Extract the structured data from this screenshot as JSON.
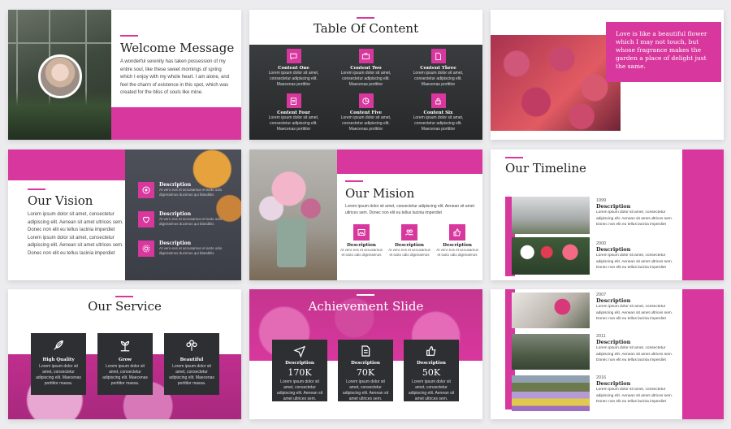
{
  "welcome": {
    "title": "Welcome Message",
    "body": "A wonderful serenity has taken possession of my entire soul, like these sweet mornings of spring which I enjoy with my whole heart. I am alone, and feel the charm of existence in this spot, which was created for the bliss of souls like mine."
  },
  "toc": {
    "title": "Table Of Content",
    "items": [
      {
        "label": "Content One",
        "icon": "chat-bubble-icon"
      },
      {
        "label": "Content Two",
        "icon": "briefcase-icon"
      },
      {
        "label": "Content Three",
        "icon": "document-icon"
      },
      {
        "label": "Content Four",
        "icon": "clipboard-icon"
      },
      {
        "label": "Content Five",
        "icon": "pie-chart-icon"
      },
      {
        "label": "Content Six",
        "icon": "lock-icon"
      }
    ],
    "text": "Lorem ipsum dolor sit amet, consectetur adipiscing elit. Maecenas porttitor"
  },
  "quote": {
    "text": "Love is like a beautiful flower which I may not touch, but whose fragrance makes the garden a place of delight just the same."
  },
  "vision": {
    "title": "Our Vision",
    "body": "Lorem ipsum dolor sit amet, consectetur adipiscing elit. Aenean sit amet ultrices sem. Donec non elit eu tellus lacinia imperdiet Lorem ipsum dolor sit amet, consectetur adipiscing elit. Aenean sit amet ultrices sem. Donec non elit eu tellus lacinia imperdiet",
    "items": [
      {
        "label": "Description",
        "icon": "target-icon"
      },
      {
        "label": "Description",
        "icon": "heart-icon"
      },
      {
        "label": "Description",
        "icon": "gear-icon"
      }
    ],
    "item_text": "At vero eos et accusamus et iusto odio dignissimos ducimus qui blanditiis"
  },
  "mission": {
    "title": "Our Mision",
    "body": "Lorem ipsum dolor sit amet, consectetur adipiscing elit. Aenean sit amet ultrices sem. Donec non elit eu tellus lacinia imperdiet",
    "items": [
      {
        "label": "Description",
        "icon": "picture-icon"
      },
      {
        "label": "Description",
        "icon": "people-icon"
      },
      {
        "label": "Description",
        "icon": "thumbs-up-icon"
      }
    ],
    "item_text": "At vero eos et accusamus et iusto odio dignissimos"
  },
  "timeline1": {
    "title": "Our Timeline",
    "entries": [
      {
        "year": "1999",
        "label": "Description"
      },
      {
        "year": "2000",
        "label": "Description"
      }
    ],
    "text": "Lorem ipsum dolor sit amet, consectetur adipiscing elit. Aenean sit amet ultrices sem. Donec non elit eu tellus lacinia imperdiet"
  },
  "service": {
    "title": "Our Service",
    "items": [
      {
        "label": "High Quality",
        "icon": "feather-icon"
      },
      {
        "label": "Grow",
        "icon": "plant-icon"
      },
      {
        "label": "Beautiful",
        "icon": "flower-icon"
      }
    ],
    "text": "Lorem ipsum dolor sit amet, consectetur adipiscing elit. Maecenas porttitor massa."
  },
  "achievement": {
    "title": "Achievement Slide",
    "items": [
      {
        "label": "Description",
        "value": "170K",
        "icon": "paper-plane-icon"
      },
      {
        "label": "Description",
        "value": "70K",
        "icon": "document-icon"
      },
      {
        "label": "Description",
        "value": "50K",
        "icon": "thumbs-up-icon"
      }
    ],
    "text": "Lorem ipsum dolor sit amet, consectetur adipiscing elit. Aenean sit amet ultrices sem."
  },
  "timeline2": {
    "entries": [
      {
        "year": "2007",
        "label": "Description"
      },
      {
        "year": "2011",
        "label": "Description"
      },
      {
        "year": "2016",
        "label": "Description"
      }
    ],
    "text": "Lorem ipsum dolor sit amet, consectetur adipiscing elit. Aenean sit amet ultrices sem. Donec non elit eu tellus lacinia imperdiet"
  },
  "colors": {
    "accent": "#d8379d",
    "dark": "#2d2f32"
  }
}
